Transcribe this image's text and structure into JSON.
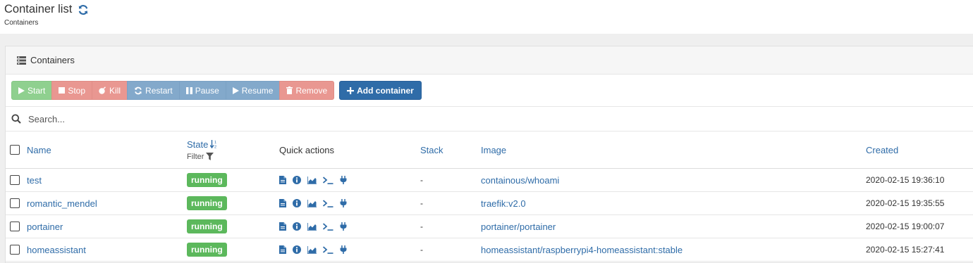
{
  "header": {
    "title": "Container list",
    "subtitle": "Containers",
    "refresh_icon": "refresh-icon"
  },
  "widget": {
    "title": "Containers",
    "icon": "list-icon"
  },
  "toolbar": {
    "start": "Start",
    "stop": "Stop",
    "kill": "Kill",
    "restart": "Restart",
    "pause": "Pause",
    "resume": "Resume",
    "remove": "Remove",
    "add": "Add container"
  },
  "search": {
    "placeholder": "Search..."
  },
  "table": {
    "columns": {
      "name": "Name",
      "state": "State",
      "filter": "Filter",
      "quick_actions": "Quick actions",
      "stack": "Stack",
      "image": "Image",
      "created": "Created"
    },
    "rows": [
      {
        "name": "test",
        "state": "running",
        "stack": "-",
        "image": "containous/whoami",
        "created": "2020-02-15 19:36:10"
      },
      {
        "name": "romantic_mendel",
        "state": "running",
        "stack": "-",
        "image": "traefik:v2.0",
        "created": "2020-02-15 19:35:55"
      },
      {
        "name": "portainer",
        "state": "running",
        "stack": "-",
        "image": "portainer/portainer",
        "created": "2020-02-15 19:00:07"
      },
      {
        "name": "homeassistant",
        "state": "running",
        "stack": "-",
        "image": "homeassistant/raspberrypi4-homeassistant:stable",
        "created": "2020-02-15 15:27:41"
      }
    ]
  },
  "colors": {
    "accent": "#2f6ca8",
    "running": "#5cb85c",
    "start_button": "#8fd08f",
    "danger_button": "#e99791",
    "info_button": "#83a9cb"
  }
}
